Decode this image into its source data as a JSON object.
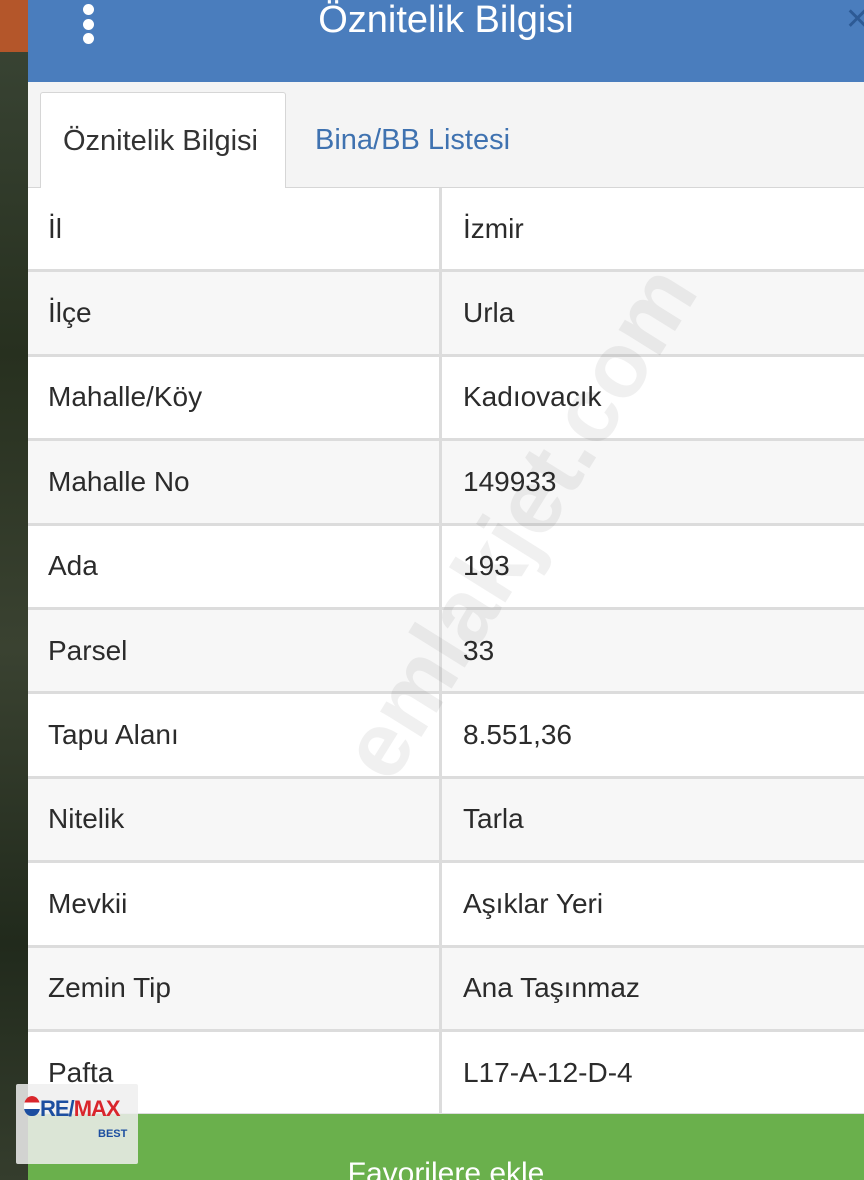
{
  "header": {
    "title": "Öznitelik Bilgisi"
  },
  "tabs": [
    {
      "label": "Öznitelik Bilgisi",
      "active": true
    },
    {
      "label": "Bina/BB Listesi",
      "active": false
    }
  ],
  "attributes": [
    {
      "key": "İl",
      "value": "İzmir"
    },
    {
      "key": "İlçe",
      "value": "Urla"
    },
    {
      "key": "Mahalle/Köy",
      "value": "Kadıovacık"
    },
    {
      "key": "Mahalle No",
      "value": "149933"
    },
    {
      "key": "Ada",
      "value": "193"
    },
    {
      "key": "Parsel",
      "value": "33"
    },
    {
      "key": "Tapu Alanı",
      "value": "8.551,36"
    },
    {
      "key": "Nitelik",
      "value": "Tarla"
    },
    {
      "key": "Mevkii",
      "value": "Aşıklar Yeri"
    },
    {
      "key": "Zemin Tip",
      "value": "Ana Taşınmaz"
    },
    {
      "key": "Pafta",
      "value": "L17-A-12-D-4"
    }
  ],
  "actions": {
    "favorite_label": "Favorilere ekle"
  },
  "watermark": "emlakjet.com",
  "logo": {
    "brand_a": "RE/",
    "brand_b": "MAX",
    "sub": "BEST"
  },
  "colors": {
    "header": "#4a7dbd",
    "tab_link": "#3f72b0",
    "button": "#6ab04c"
  }
}
